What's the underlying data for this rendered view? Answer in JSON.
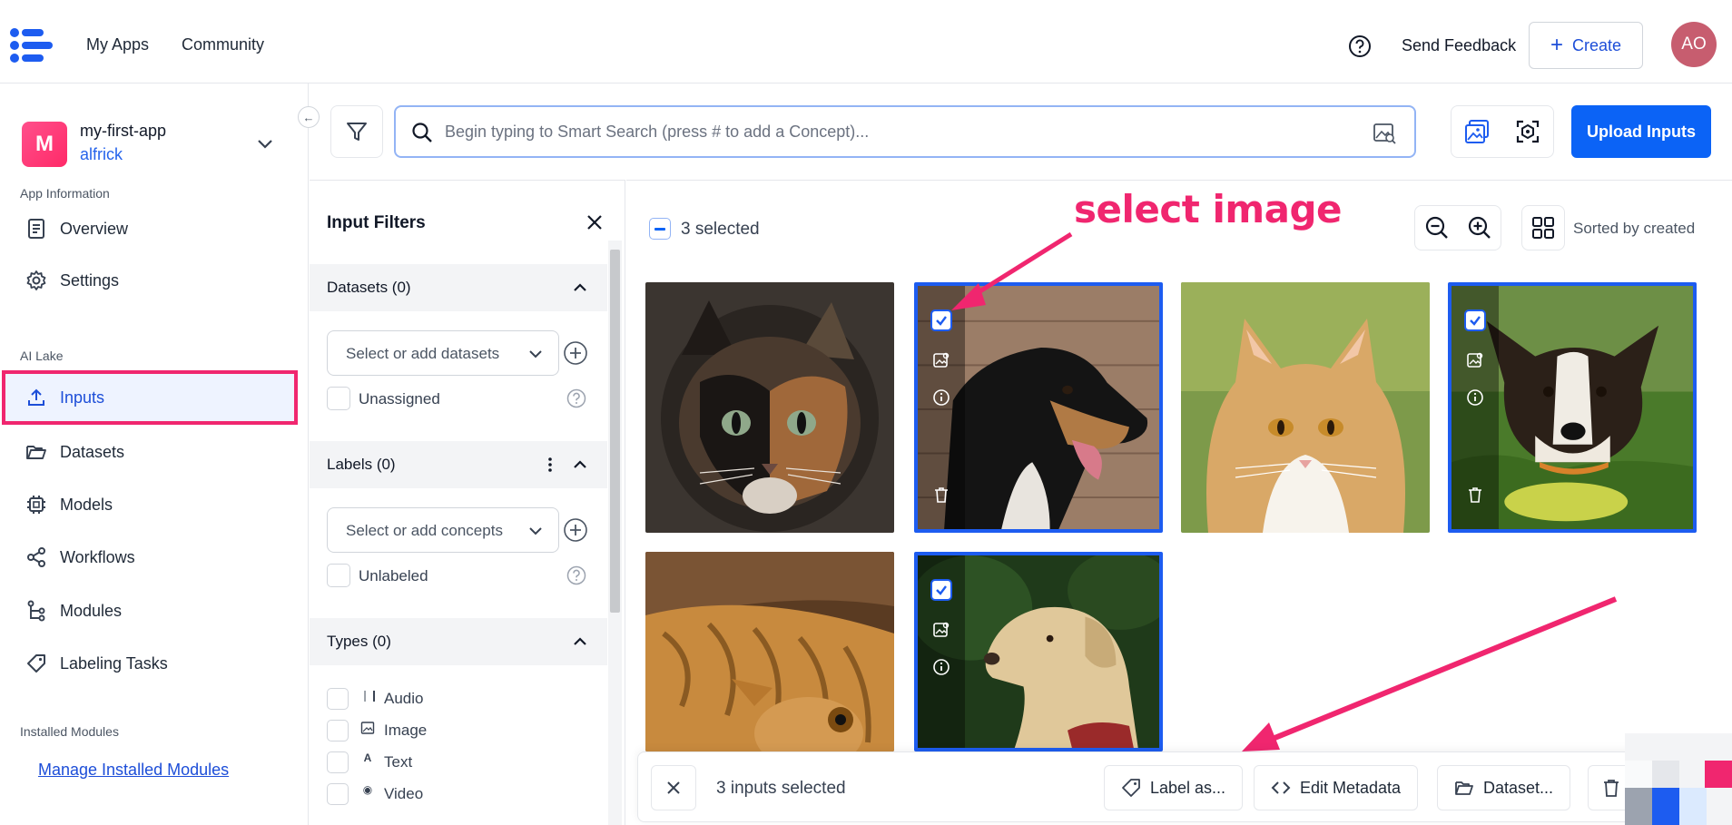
{
  "header": {
    "nav": [
      "My Apps",
      "Community"
    ],
    "send_feedback": "Send Feedback",
    "create": "Create",
    "avatar_initials": "AO"
  },
  "sidebar": {
    "app_initial": "M",
    "app_name": "my-first-app",
    "app_user": "alfrick",
    "app_info_label": "App Information",
    "app_items": [
      {
        "label": "Overview",
        "icon": "document-icon"
      },
      {
        "label": "Settings",
        "icon": "gear-icon"
      }
    ],
    "ai_lake_label": "AI Lake",
    "lake_items": [
      {
        "label": "Inputs",
        "icon": "upload-icon",
        "active": true
      },
      {
        "label": "Datasets",
        "icon": "folder-icon"
      },
      {
        "label": "Models",
        "icon": "chip-icon"
      },
      {
        "label": "Workflows",
        "icon": "share-icon"
      },
      {
        "label": "Modules",
        "icon": "tree-icon"
      },
      {
        "label": "Labeling Tasks",
        "icon": "tag-icon"
      }
    ],
    "installed_label": "Installed Modules",
    "manage_link": "Manage Installed Modules"
  },
  "search": {
    "placeholder": "Begin typing to Smart Search (press # to add a Concept)...",
    "upload_button": "Upload Inputs"
  },
  "filters": {
    "title": "Input Filters",
    "datasets": {
      "header": "Datasets (0)",
      "select_placeholder": "Select or add datasets",
      "checkbox": "Unassigned"
    },
    "labels": {
      "header": "Labels (0)",
      "select_placeholder": "Select or add concepts",
      "checkbox": "Unlabeled"
    },
    "types": {
      "header": "Types (0)",
      "options": [
        {
          "label": "Audio",
          "glyph": "❘❙"
        },
        {
          "label": "Image",
          "glyph": ""
        },
        {
          "label": "Text",
          "glyph": "A"
        },
        {
          "label": "Video",
          "glyph": "◉"
        }
      ]
    }
  },
  "gallery": {
    "selected_count": "3 selected",
    "sort_label": "Sorted by created",
    "items": [
      {
        "subject": "tortoiseshell cat",
        "selected": false
      },
      {
        "subject": "black and tan dog",
        "selected": true
      },
      {
        "subject": "orange and white cat",
        "selected": false
      },
      {
        "subject": "terrier dog on grass",
        "selected": true
      },
      {
        "subject": "tabby cat lying",
        "selected": false
      },
      {
        "subject": "yellow labrador",
        "selected": true
      }
    ]
  },
  "annotation": {
    "text": "select image",
    "color": "#f0266f"
  },
  "action_bar": {
    "count": "3 inputs selected",
    "label_as": "Label as...",
    "edit_metadata": "Edit Metadata",
    "dataset": "Dataset..."
  },
  "colors": {
    "accent": "#0b63f6",
    "highlight": "#f0266f",
    "selected_border": "#1d5cf0"
  }
}
